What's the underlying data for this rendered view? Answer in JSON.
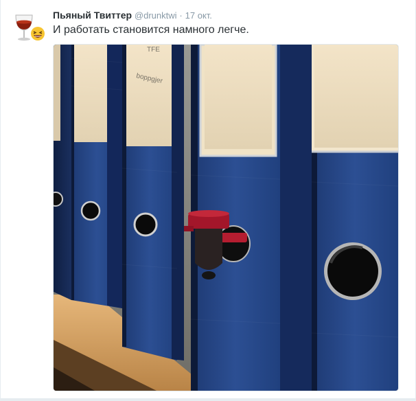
{
  "tweet": {
    "fullname": "Пьяный Твиттер",
    "username": "@drunktwi",
    "separator": "·",
    "timestamp": "17 окт.",
    "text": "И работать становится намного легче."
  },
  "avatar_icon": "wine-glass-laughing-emoji-icon",
  "photo": {
    "subject": "blue office binders on a shelf, one fitted with a red wine-box tap",
    "label_texts": [
      "TFE",
      "boppgjer"
    ]
  },
  "colors": {
    "name": "#292f33",
    "meta": "#8899a6",
    "binder_blue": "#2a4a8c",
    "tap_red": "#a3162a"
  }
}
